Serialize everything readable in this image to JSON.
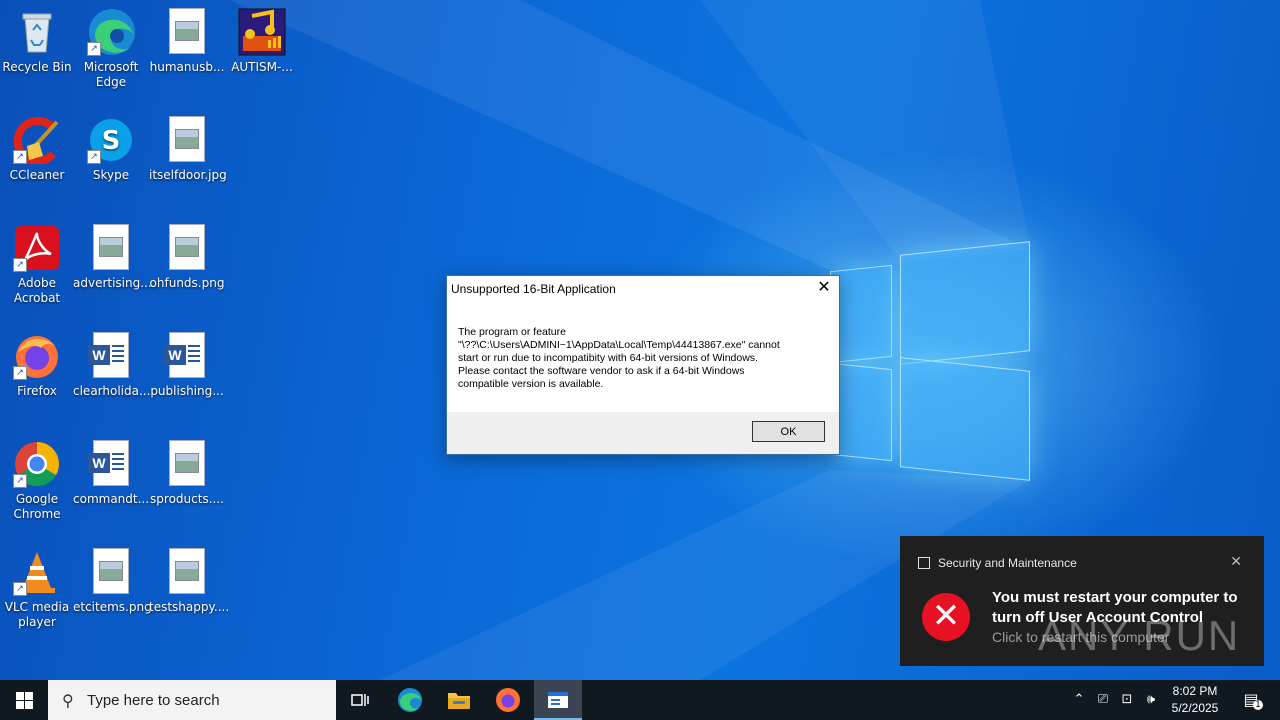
{
  "desktop": {
    "icons": [
      {
        "label": "Recycle Bin",
        "icon": "recycle-bin-icon"
      },
      {
        "label": "Microsoft Edge",
        "icon": "edge-icon"
      },
      {
        "label": "humanusb...",
        "icon": "image-file-icon"
      },
      {
        "label": "AUTISM-...",
        "icon": "music-app-icon"
      },
      {
        "label": "CCleaner",
        "icon": "ccleaner-icon"
      },
      {
        "label": "Skype",
        "icon": "skype-icon"
      },
      {
        "label": "itselfdoor.jpg",
        "icon": "image-file-icon"
      },
      {
        "label": "Adobe Acrobat",
        "icon": "acrobat-icon"
      },
      {
        "label": "advertising...",
        "icon": "image-file-icon"
      },
      {
        "label": "ohfunds.png",
        "icon": "image-file-icon"
      },
      {
        "label": "Firefox",
        "icon": "firefox-icon"
      },
      {
        "label": "clearholida...",
        "icon": "word-doc-icon"
      },
      {
        "label": "publishing...",
        "icon": "word-doc-icon"
      },
      {
        "label": "Google Chrome",
        "icon": "chrome-icon"
      },
      {
        "label": "commandt...",
        "icon": "word-doc-icon"
      },
      {
        "label": "sproducts....",
        "icon": "image-file-icon"
      },
      {
        "label": "VLC media player",
        "icon": "vlc-icon"
      },
      {
        "label": "etcitems.png",
        "icon": "image-file-icon"
      },
      {
        "label": "testshappy....",
        "icon": "image-file-icon"
      }
    ]
  },
  "dialog": {
    "title": "Unsupported 16-Bit Application",
    "message": "The program or feature\n\"\\??\\C:\\Users\\ADMINI~1\\AppData\\Local\\Temp\\44413867.exe\" cannot\nstart or run due to incompatibity with 64-bit versions of Windows.\nPlease contact the software vendor to ask if a 64-bit Windows\ncompatible version is available.",
    "ok_label": "OK"
  },
  "toast": {
    "source": "Security and Maintenance",
    "title": "You must restart your computer to turn off User Account Control",
    "body": "Click to restart this computer"
  },
  "watermark": "ANY RUN",
  "taskbar": {
    "search_placeholder": "Type here to search",
    "time": "8:02 PM",
    "date": "5/2/2025",
    "notification_count": "1"
  },
  "colors": {
    "desktop_blue": "#0b67d6",
    "taskbar": "#101820",
    "error_red": "#e81123",
    "toast_bg": "#1f1f1f"
  }
}
